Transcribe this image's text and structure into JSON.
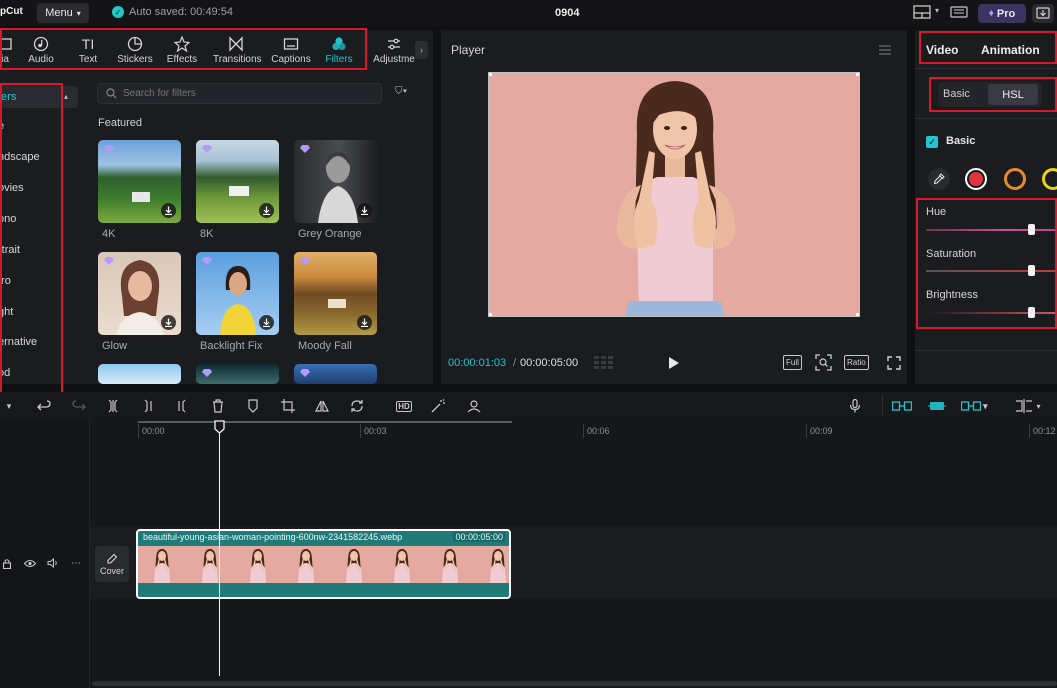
{
  "app": {
    "logo_text": "pCut",
    "menu_label": "Menu",
    "autosave_text": "Auto saved: 00:49:54",
    "project_title": "0904",
    "pro_label": "Pro"
  },
  "tools": [
    {
      "label": "ia",
      "icon": "media-icon"
    },
    {
      "label": "Audio",
      "icon": "audio-icon"
    },
    {
      "label": "Text",
      "icon": "text-icon"
    },
    {
      "label": "Stickers",
      "icon": "stickers-icon"
    },
    {
      "label": "Effects",
      "icon": "effects-icon"
    },
    {
      "label": "Transitions",
      "icon": "transitions-icon"
    },
    {
      "label": "Captions",
      "icon": "captions-icon"
    },
    {
      "label": "Filters",
      "icon": "filters-icon",
      "active": true
    },
    {
      "label": "Adjustme",
      "icon": "adjustment-icon"
    }
  ],
  "categories": [
    "ters",
    "e",
    "ndscape",
    "ovies",
    "ono",
    "rtrait",
    "tro",
    "ght",
    "ernative",
    "od"
  ],
  "search": {
    "placeholder": "Search for filters"
  },
  "featured_label": "Featured",
  "filters": [
    {
      "name": "4K",
      "premium": true
    },
    {
      "name": "8K",
      "premium": true
    },
    {
      "name": "Grey Orange",
      "premium": true
    },
    {
      "name": "Glow",
      "premium": true
    },
    {
      "name": "Backlight Fix",
      "premium": true
    },
    {
      "name": "Moody Fall",
      "premium": true
    }
  ],
  "player": {
    "title": "Player",
    "current_time": "00:00:01:03",
    "total_time": "00:00:05:00",
    "full_label": "Full",
    "ratio_label": "Ratio"
  },
  "right_panel": {
    "tabs": [
      "Video",
      "Animation"
    ],
    "segments": {
      "basic": "Basic",
      "hsl": "HSL"
    },
    "basic_checkbox_label": "Basic",
    "swatch_colors": [
      "#e0353a",
      "#e68a2e",
      "#e8d21a"
    ],
    "sliders": [
      {
        "label": "Hue",
        "value": 0.8
      },
      {
        "label": "Saturation",
        "value": 0.8
      },
      {
        "label": "Brightness",
        "value": 0.8
      }
    ]
  },
  "timeline": {
    "ruler_labels": [
      "00:00",
      "00:03",
      "00:06",
      "00:09",
      "00:12"
    ],
    "cover_label": "Cover",
    "clip_name": "beautiful-young-asian-woman-pointing-600nw-2341582245.webp",
    "clip_duration": "00:00:05:00",
    "hd_label": "HD"
  },
  "colors": {
    "accent": "#21c5cf",
    "highlight_box": "#d8192b",
    "backdrop": "#e4a9a1",
    "clip": "#1f7a78"
  }
}
